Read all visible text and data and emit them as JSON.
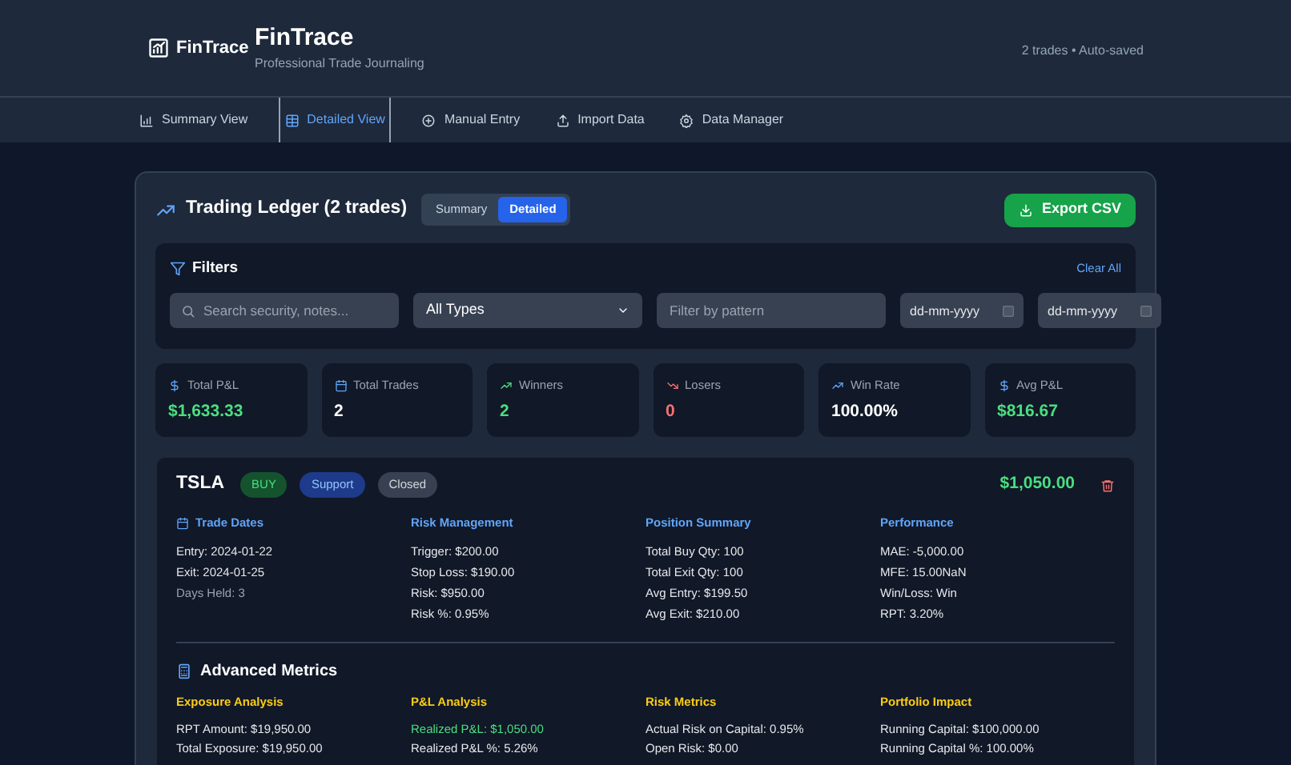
{
  "header": {
    "logo_text": "FinTrace",
    "title": "FinTrace",
    "subtitle": "Professional Trade Journaling",
    "status": "2 trades • Auto-saved"
  },
  "nav": [
    {
      "label": "Summary View",
      "selected": false
    },
    {
      "label": "Detailed View",
      "selected": true
    },
    {
      "label": "Manual Entry",
      "selected": false
    },
    {
      "label": "Import Data",
      "selected": false
    },
    {
      "label": "Data Manager",
      "selected": false
    }
  ],
  "ledger": {
    "title": "Trading Ledger (2 trades)",
    "view_toggle": [
      {
        "label": "Summary",
        "selected": false
      },
      {
        "label": "Detailed",
        "selected": true
      }
    ],
    "export_button": "Export CSV"
  },
  "filters": {
    "title": "Filters",
    "clear_all": "Clear All",
    "search": {
      "placeholder": "Search security, notes..."
    },
    "type_select": {
      "value": "All Types"
    },
    "pattern": {
      "placeholder": "Filter by pattern"
    },
    "dates": [
      {
        "placeholder": "dd-mm-yyyy"
      },
      {
        "placeholder": "dd-mm-yyyy"
      }
    ]
  },
  "stats": [
    {
      "label": "Total P&L",
      "value": "$1,633.33",
      "color": "#4ade80"
    },
    {
      "label": "Total Trades",
      "value": "2",
      "color": "#ffffff"
    },
    {
      "label": "Winners",
      "value": "2",
      "color": "#4ade80"
    },
    {
      "label": "Losers",
      "value": "0",
      "color": "#f87171"
    },
    {
      "label": "Win Rate",
      "value": "100.00%",
      "color": "#ffffff"
    },
    {
      "label": "Avg P&L",
      "value": "$816.67",
      "color": "#4ade80"
    }
  ],
  "trades": [
    {
      "symbol": "TSLA",
      "side": "BUY",
      "setup": "Support",
      "status": "Closed",
      "pnl": "$1,050.00",
      "sections": [
        {
          "title": "Trade Dates",
          "lines": [
            {
              "text": "Entry: 2024-01-22",
              "kind": "normal"
            },
            {
              "text": "Exit: 2024-01-25",
              "kind": "normal"
            },
            {
              "text": "Days Held: 3",
              "kind": "muted"
            }
          ]
        },
        {
          "title": "Risk Management",
          "lines": [
            {
              "text": "Trigger: $200.00",
              "kind": "normal"
            },
            {
              "text": "Stop Loss: $190.00",
              "kind": "normal"
            },
            {
              "text": "Risk: $950.00",
              "kind": "normal"
            },
            {
              "text": "Risk %: 0.95%",
              "kind": "normal"
            }
          ]
        },
        {
          "title": "Position Summary",
          "lines": [
            {
              "text": "Total Buy Qty: 100",
              "kind": "normal"
            },
            {
              "text": "Total Exit Qty: 100",
              "kind": "normal"
            },
            {
              "text": "Avg Entry: $199.50",
              "kind": "normal"
            },
            {
              "text": "Avg Exit: $210.00",
              "kind": "normal"
            }
          ]
        },
        {
          "title": "Performance",
          "lines": [
            {
              "text": "MAE: -5,000.00",
              "kind": "normal"
            },
            {
              "text": "MFE: 15.00NaN",
              "kind": "normal"
            },
            {
              "text": "Win/Loss: Win",
              "kind": "normal"
            },
            {
              "text": "RPT: 3.20%",
              "kind": "normal"
            }
          ]
        }
      ],
      "advanced": {
        "title": "Advanced Metrics",
        "sections": [
          {
            "title": "Exposure Analysis",
            "lines": [
              {
                "text": "RPT Amount: $19,950.00",
                "kind": "normal"
              },
              {
                "text": "Total Exposure: $19,950.00",
                "kind": "normal"
              }
            ]
          },
          {
            "title": "P&L Analysis",
            "lines": [
              {
                "text": "Realized P&L: $1,050.00",
                "kind": "positive"
              },
              {
                "text": "Realized P&L %: 5.26%",
                "kind": "normal"
              }
            ]
          },
          {
            "title": "Risk Metrics",
            "lines": [
              {
                "text": "Actual Risk on Capital: 0.95%",
                "kind": "normal"
              },
              {
                "text": "Open Risk: $0.00",
                "kind": "normal"
              }
            ]
          },
          {
            "title": "Portfolio Impact",
            "lines": [
              {
                "text": "Running Capital: $100,000.00",
                "kind": "normal"
              },
              {
                "text": "Running Capital %: 100.00%",
                "kind": "normal"
              }
            ]
          }
        ]
      }
    }
  ]
}
